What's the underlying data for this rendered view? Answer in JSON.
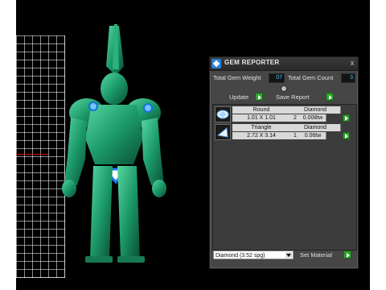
{
  "panel": {
    "title": "GEM REPORTER",
    "close_label": "x",
    "total_weight_label": "Total Gem Weight",
    "total_weight_value": "07",
    "total_count_label": "Total Gem Count",
    "total_count_value": "3",
    "update_label": "Update",
    "save_report_label": "Save Report",
    "gems": [
      {
        "shape": "Round",
        "material": "Diamond",
        "size": "1.01 X 1.01",
        "count": "2",
        "weight": "0.008tw"
      },
      {
        "shape": "Triangle",
        "material": "Diamond",
        "size": "2.72 X 3.14",
        "count": "1",
        "weight": "0.06tw"
      }
    ],
    "material_select": {
      "selected": "Diamond     (3.52 spg)"
    },
    "set_material_label": "Set Material"
  },
  "colors": {
    "viewport_bg": "#000000",
    "model_green": "#1e9b6c",
    "accent_green": "#2fa12f",
    "value_blue": "#45c0ff",
    "panel_bg": "#464646"
  }
}
